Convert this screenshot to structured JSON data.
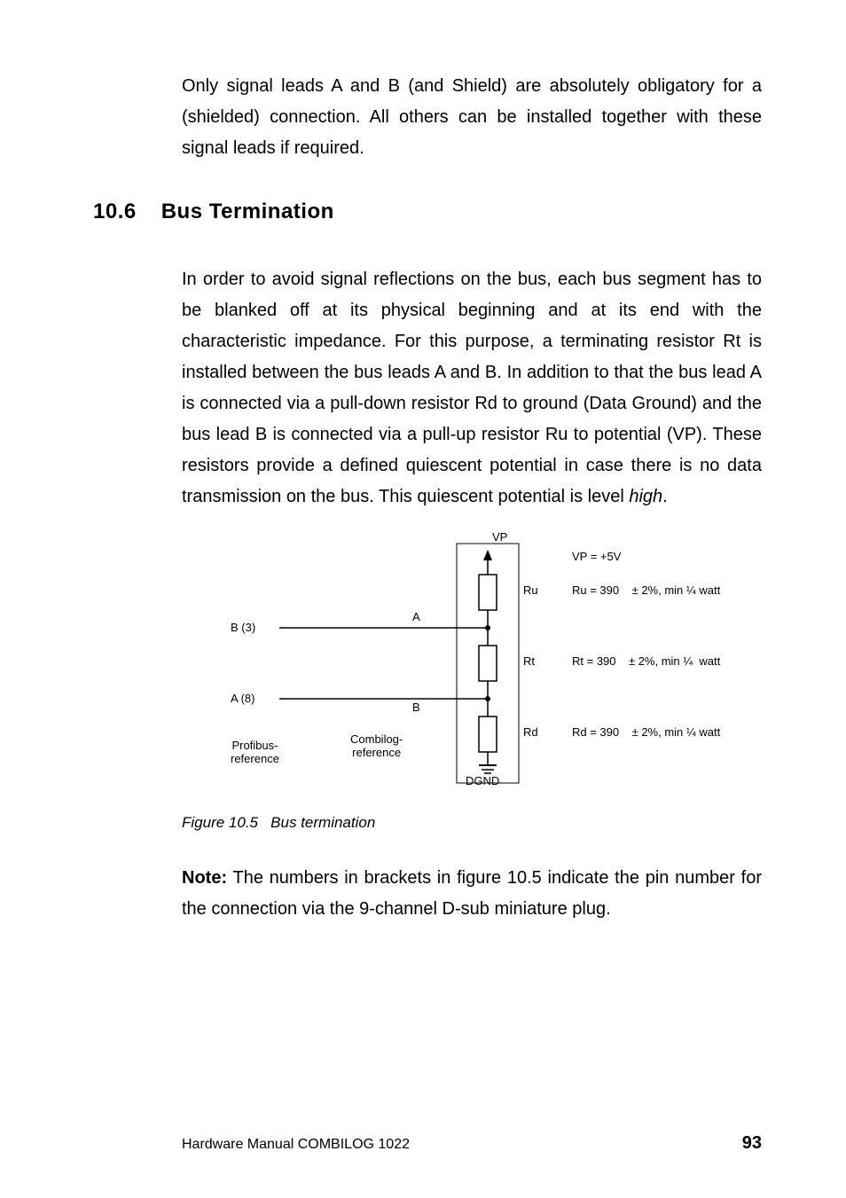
{
  "intro_paragraph": "Only signal leads A and B (and Shield) are absolutely obligatory for a (shielded) connection. All others can be installed together with these signal leads if required.",
  "section": {
    "number": "10.6",
    "title": "Bus Termination"
  },
  "main_paragraph_part1": "In order to avoid signal reflections on the bus, each bus segment has to be blanked off at its physical beginning and at its end with the characteristic impedance. For this purpose, a terminating resistor Rt is installed between the bus leads A and B. In addition to that the bus lead A is connected via a pull-down resistor Rd to ground (Data Ground) and the bus lead B is connected via a pull-up resistor Ru to potential (VP). These resistors provide a defined quiescent potential in case there is no data transmission on the bus. This quiescent potential is level ",
  "main_paragraph_high": "high",
  "main_paragraph_period": ".",
  "figure": {
    "vp_top": "VP",
    "ru": "Ru",
    "rt": "Rt",
    "rd": "Rd",
    "dgnd": "DGND",
    "a_label": "A",
    "b_label": "B",
    "b3": "B (3)",
    "a8": "A (8)",
    "profibus_ref_l1": "Profibus-",
    "profibus_ref_l2": "reference",
    "combilog_ref_l1": "Combilog-",
    "combilog_ref_l2": "reference",
    "vp5v": "VP = +5V",
    "ru_spec": "Ru = 390    ± 2%, min ¼ watt",
    "rt_spec": "Rt = 390    ± 2%, min ¼  watt",
    "rd_spec": "Rd = 390    ± 2%, min ¼ watt"
  },
  "figure_caption_label": "Figure 10.5",
  "figure_caption_text": "Bus termination",
  "note_label": "Note:",
  "note_text": " The numbers in brackets in figure 10.5 indicate the pin number for the connection via the 9-channel D-sub miniature plug.",
  "footer": {
    "left": "Hardware Manual COMBILOG 1022",
    "right": "93"
  }
}
